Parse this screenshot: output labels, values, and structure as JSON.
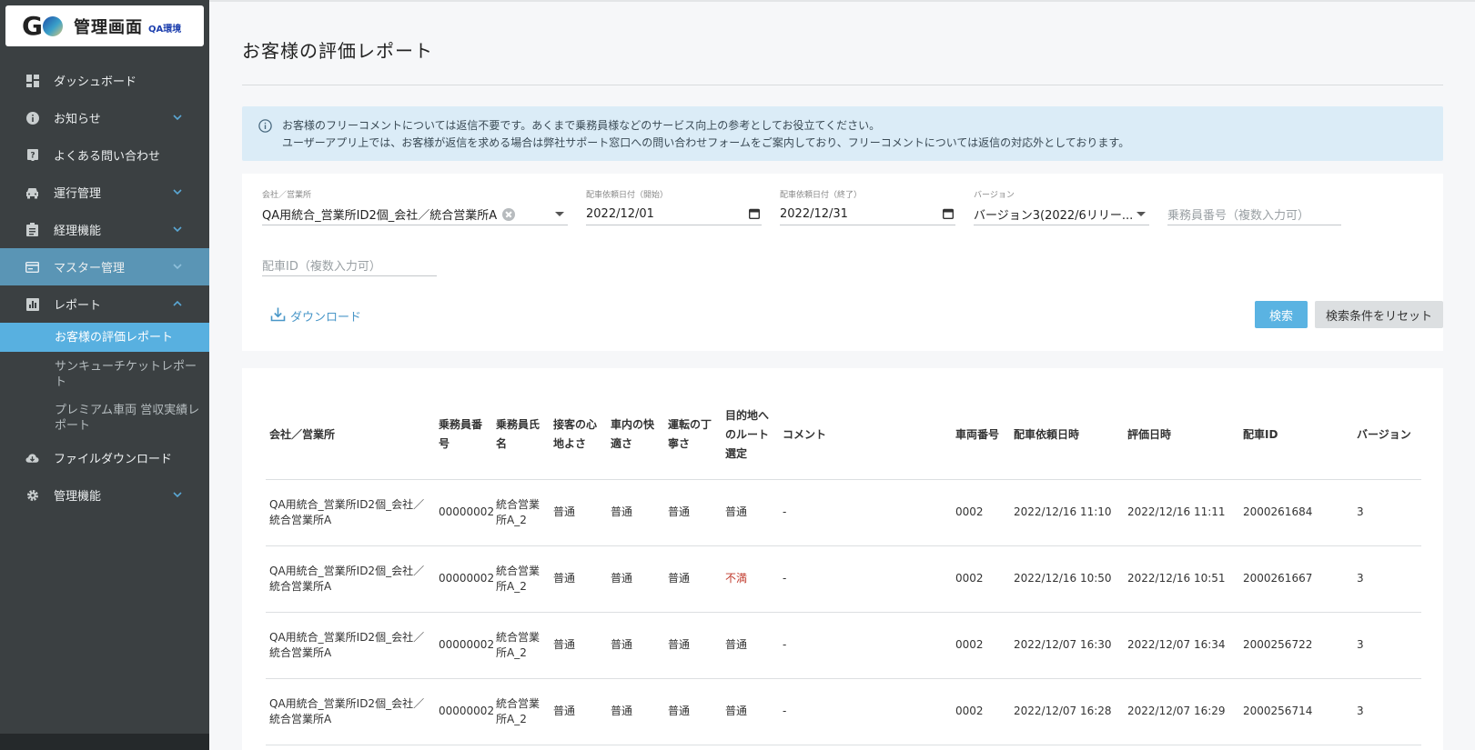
{
  "app": {
    "logo_text": "G",
    "title": "管理画面",
    "env_badge": "QA環境"
  },
  "sidebar": {
    "items": [
      {
        "label": "ダッシュボード",
        "icon": "dashboard-icon",
        "chevron": ""
      },
      {
        "label": "お知らせ",
        "icon": "info-icon",
        "chevron": "down"
      },
      {
        "label": "よくある問い合わせ",
        "icon": "help-icon",
        "chevron": ""
      },
      {
        "label": "運行管理",
        "icon": "car-icon",
        "chevron": "down"
      },
      {
        "label": "経理機能",
        "icon": "clipboard-icon",
        "chevron": "down"
      },
      {
        "label": "マスター管理",
        "icon": "card-icon",
        "chevron": "down",
        "active": true
      },
      {
        "label": "レポート",
        "icon": "chart-icon",
        "chevron": "up"
      }
    ],
    "report_sub": [
      {
        "label": "お客様の評価レポート",
        "current": true
      },
      {
        "label": "サンキューチケットレポート"
      },
      {
        "label": "プレミアム車両 営収実績レポート"
      }
    ],
    "bottom_items": [
      {
        "label": "ファイルダウンロード",
        "icon": "cloud-download-icon",
        "chevron": ""
      },
      {
        "label": "管理機能",
        "icon": "gear-icon",
        "chevron": "down"
      }
    ]
  },
  "page": {
    "title": "お客様の評価レポート",
    "info_line1": "お客様のフリーコメントについては返信不要です。あくまで乗務員様などのサービス向上の参考としてお役立てください。",
    "info_line2": "ユーザーアプリ上では、お客様が返信を求める場合は弊社サポート窓口への問い合わせフォームをご案内しており、フリーコメントについては返信の対応外としております。"
  },
  "filters": {
    "company": {
      "label": "会社／営業所",
      "value": "QA用統合_営業所ID2個_会社／統合営業所A"
    },
    "start_date": {
      "label": "配車依頼日付（開始）",
      "value": "2022/12/01"
    },
    "end_date": {
      "label": "配車依頼日付（終了）",
      "value": "2022/12/31"
    },
    "version": {
      "label": "バージョン",
      "value": "バージョン3(2022/6リリー..."
    },
    "driver_no": {
      "placeholder": "乗務員番号（複数入力可）"
    },
    "dispatch_id": {
      "placeholder": "配車ID（複数入力可）"
    },
    "download_label": "ダウンロード",
    "search_label": "検索",
    "reset_label": "検索条件をリセット"
  },
  "table": {
    "headers": [
      "会社／営業所",
      "乗務員番号",
      "乗務員氏名",
      "接客の心地よさ",
      "車内の快適さ",
      "運転の丁寧さ",
      "目的地へのルート選定",
      "コメント",
      "車両番号",
      "配車依頼日時",
      "評価日時",
      "配車ID",
      "バージョン"
    ],
    "rows": [
      {
        "company": "QA用統合_営業所ID2個_会社／統合営業所A",
        "driver_no": "00000002",
        "driver_name": "統合営業所A_2",
        "service": "普通",
        "comfort": "普通",
        "driving": "普通",
        "route": "普通",
        "comment": "-",
        "vehicle": "0002",
        "requested": "2022/12/16 11:10",
        "rated": "2022/12/16 11:11",
        "dispatch_id": "2000261684",
        "version": "3"
      },
      {
        "company": "QA用統合_営業所ID2個_会社／統合営業所A",
        "driver_no": "00000002",
        "driver_name": "統合営業所A_2",
        "service": "普通",
        "comfort": "普通",
        "driving": "普通",
        "route": "不満",
        "comment": "-",
        "vehicle": "0002",
        "requested": "2022/12/16 10:50",
        "rated": "2022/12/16 10:51",
        "dispatch_id": "2000261667",
        "version": "3"
      },
      {
        "company": "QA用統合_営業所ID2個_会社／統合営業所A",
        "driver_no": "00000002",
        "driver_name": "統合営業所A_2",
        "service": "普通",
        "comfort": "普通",
        "driving": "普通",
        "route": "普通",
        "comment": "-",
        "vehicle": "0002",
        "requested": "2022/12/07 16:30",
        "rated": "2022/12/07 16:34",
        "dispatch_id": "2000256722",
        "version": "3"
      },
      {
        "company": "QA用統合_営業所ID2個_会社／統合営業所A",
        "driver_no": "00000002",
        "driver_name": "統合営業所A_2",
        "service": "普通",
        "comfort": "普通",
        "driving": "普通",
        "route": "普通",
        "comment": "-",
        "vehicle": "0002",
        "requested": "2022/12/07 16:28",
        "rated": "2022/12/07 16:29",
        "dispatch_id": "2000256714",
        "version": "3"
      }
    ]
  },
  "colors": {
    "sidebar_bg": "#3b4042",
    "active_item": "#5a95b5",
    "current_sub": "#58b0e0",
    "accent": "#5ab3e2",
    "warn": "#c0392b"
  }
}
